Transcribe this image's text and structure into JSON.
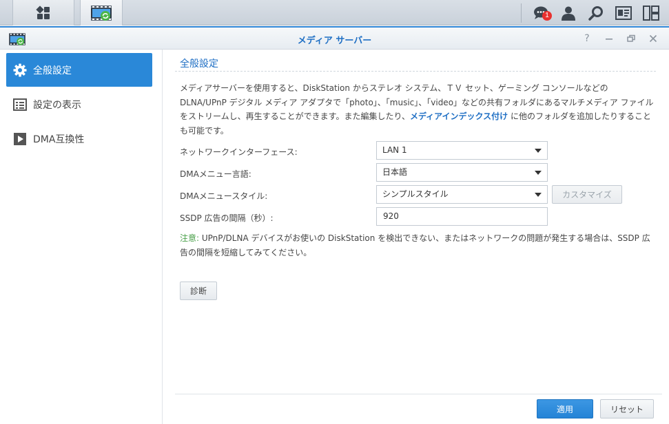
{
  "taskbar": {
    "notification_count": "1"
  },
  "window": {
    "title": "メディア サーバー",
    "help_glyph": "?"
  },
  "sidebar": {
    "items": [
      {
        "label": "全般設定",
        "icon": "gear-icon",
        "active": true
      },
      {
        "label": "設定の表示",
        "icon": "list-view-icon",
        "active": false
      },
      {
        "label": "DMA互換性",
        "icon": "play-icon",
        "active": false
      }
    ]
  },
  "main": {
    "section_title": "全般設定",
    "description_before_link": "メディアサーバーを使用すると、DiskStation からステレオ システム、ＴＶ セット、ゲーミング コンソールなどの DLNA/UPnP デジタル メディア アダプタで「photo」、「music」、「video」などの共有フォルダにあるマルチメディア ファイルをストリームし、再生することができます。また編集したり、",
    "description_link": "メディアインデックス付け",
    "description_after_link": " に他のフォルダを追加したりすることも可能です。",
    "fields": {
      "network_interface": {
        "label": "ネットワークインターフェース:",
        "value": "LAN 1"
      },
      "dma_menu_language": {
        "label": "DMAメニュー言語:",
        "value": "日本語"
      },
      "dma_menu_style": {
        "label": "DMAメニュースタイル:",
        "value": "シンプルスタイル"
      },
      "ssdp_interval": {
        "label": "SSDP 広告の間隔（秒）:",
        "value": "920"
      }
    },
    "customize_button": "カスタマイズ",
    "note_label": "注意:",
    "note_text": " UPnP/DLNA デバイスがお使いの DiskStation を検出できない、またはネットワークの問題が発生する場合は、SSDP 広告の間隔を短縮してみてください。",
    "diagnose_button": "診断"
  },
  "footer": {
    "apply_button": "適用",
    "reset_button": "リセット"
  },
  "colors": {
    "accent": "#2a88d8",
    "title": "#1f6fc4",
    "note_label": "#4aa04a",
    "badge": "#e8312f"
  }
}
